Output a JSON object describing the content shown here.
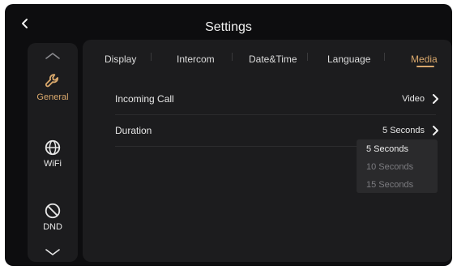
{
  "header": {
    "title": "Settings",
    "back_icon": "chevron-left-icon"
  },
  "sidebar": {
    "items": [
      {
        "label": "General",
        "icon": "wrench-icon",
        "active": true
      },
      {
        "label": "WiFi",
        "icon": "globe-icon",
        "active": false
      },
      {
        "label": "DND",
        "icon": "no-entry-icon",
        "active": false
      }
    ],
    "scroll_up_icon": "chevron-up-icon",
    "scroll_down_icon": "chevron-down-icon"
  },
  "tabs": [
    {
      "label": "Display",
      "active": false
    },
    {
      "label": "Intercom",
      "active": false
    },
    {
      "label": "Date&Time",
      "active": false
    },
    {
      "label": "Language",
      "active": false
    },
    {
      "label": "Media",
      "active": true
    }
  ],
  "settings": [
    {
      "label": "Incoming Call",
      "value": "Video"
    },
    {
      "label": "Duration",
      "value": "5 Seconds"
    }
  ],
  "duration_dropdown": {
    "options": [
      "5 Seconds",
      "10 Seconds",
      "15 Seconds"
    ],
    "selected": "5 Seconds"
  },
  "colors": {
    "accent": "#d9a86c",
    "background": "#0d0d0f",
    "panel": "#1c1c1e",
    "dropdown": "#2a2a2c",
    "text": "#e6e6e6",
    "muted_text": "#7c7c80"
  }
}
